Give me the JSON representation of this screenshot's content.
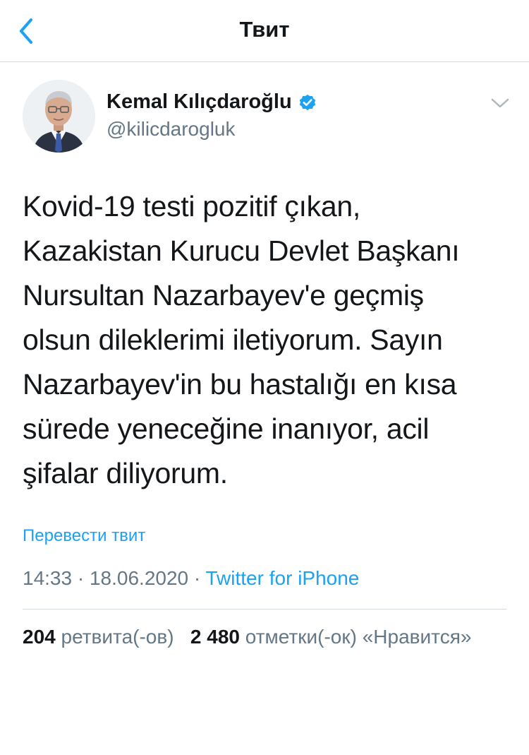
{
  "header": {
    "title": "Твит"
  },
  "tweet": {
    "author": {
      "name": "Kemal Kılıçdaroğlu",
      "handle": "@kilicdarogluk",
      "verified": true
    },
    "text": "Kovid-19 testi pozitif çıkan,\nKazakistan Kurucu Devlet Başkanı\nNursultan Nazarbayev'e geçmiş\nolsun dileklerimi iletiyorum. Sayın\nNazarbayev'in bu hastalığı en kısa\nsürede yeneceğine inanıyor, acil\nşifalar diliyorum.",
    "translate_label": "Перевести твит",
    "time": "14:33",
    "date": "18.06.2020",
    "separator": "·",
    "source": "Twitter for iPhone",
    "stats": {
      "retweets_count": "204",
      "retweets_label": "ретвита(-ов)",
      "likes_count": "2 480",
      "likes_label": "отметки(-ок) «Нравится»"
    }
  },
  "colors": {
    "accent": "#1da1f2",
    "text": "#14171a",
    "secondary": "#657786",
    "divider": "#d6dbe0"
  },
  "icons": {
    "back": "chevron-left-icon",
    "verified": "verified-badge-icon",
    "menu": "chevron-down-icon"
  }
}
